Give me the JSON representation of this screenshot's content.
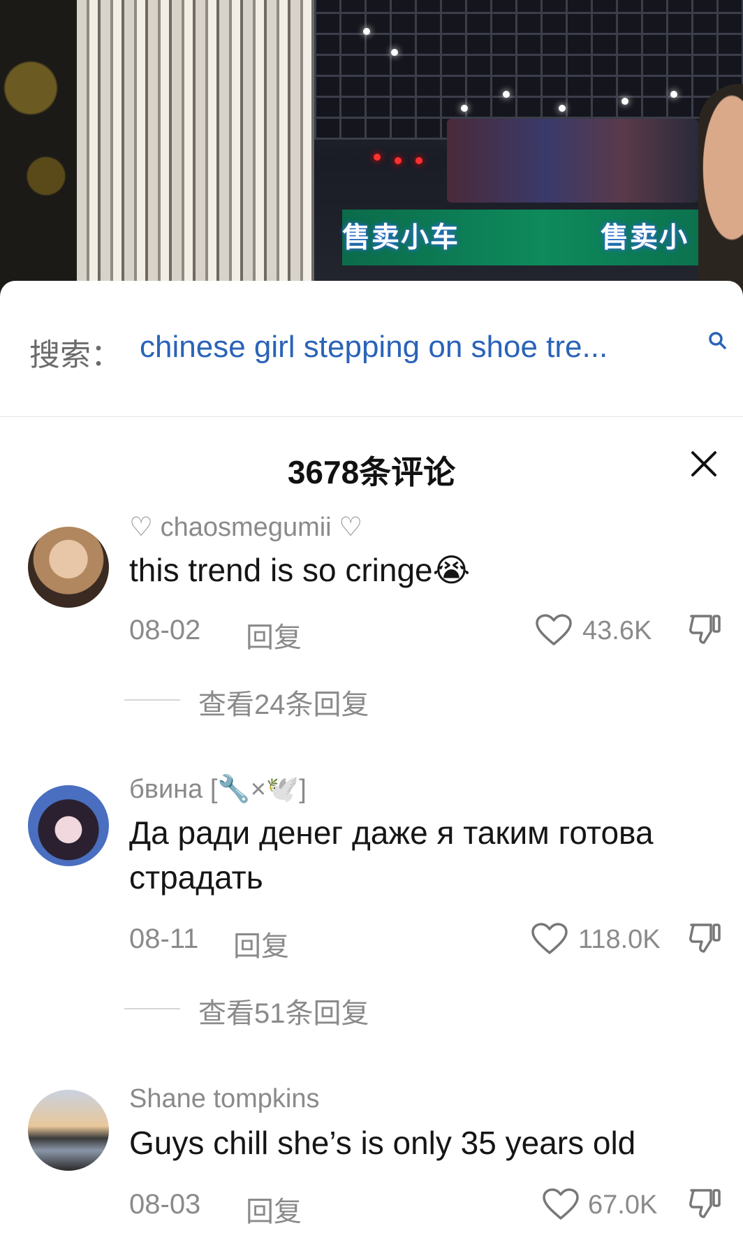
{
  "search": {
    "prefix": "搜索：",
    "query": "chinese girl stepping on shoe tre..."
  },
  "video": {
    "banner_left": "售卖小车",
    "banner_right": "售卖小"
  },
  "comments_header": {
    "title": "3678条评论"
  },
  "comments": [
    {
      "username": "♡ chaosmegumii ♡",
      "text": "this trend is so cringe😭",
      "date": "08-02",
      "reply_label": "回复",
      "likes": "43.6K",
      "view_replies": "查看24条回复"
    },
    {
      "username": "бвина [🔧×🕊️]",
      "text": "Да ради денег даже я таким готова страдать",
      "date": "08-11",
      "reply_label": "回复",
      "likes": "118.0K",
      "view_replies": "查看51条回复"
    },
    {
      "username": "Shane tompkins",
      "text": "Guys chill she’s is only 35 years old",
      "date": "08-03",
      "reply_label": "回复",
      "likes": "67.0K"
    }
  ],
  "colors": {
    "accent_link": "#2a63b8",
    "muted": "#8a8a8a",
    "text": "#151515"
  }
}
